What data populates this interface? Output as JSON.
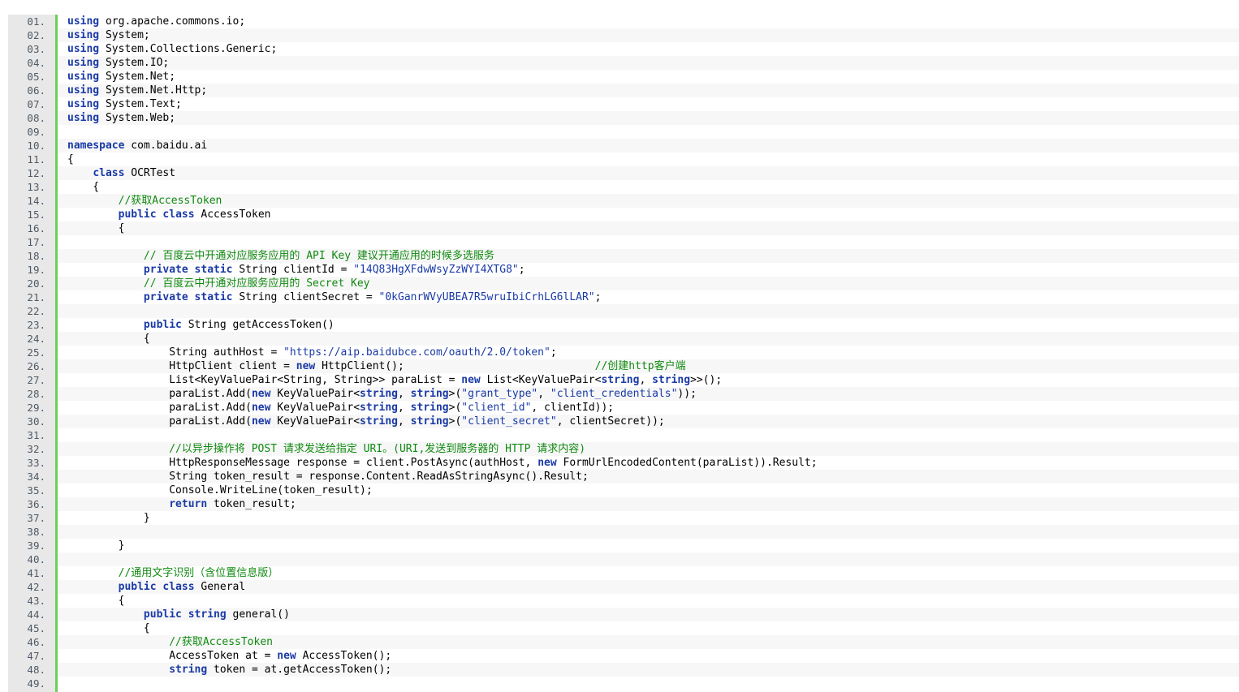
{
  "viewer": {
    "accent_gutter": "#6ccf5a",
    "colors": {
      "keyword": "#1a3aa6",
      "string": "#1a3aa6",
      "comment": "#108a10",
      "text": "#000000"
    },
    "lines": [
      {
        "n": "01.",
        "t": [
          [
            "kw",
            "using"
          ],
          [
            "tx",
            " org.apache.commons.io;"
          ]
        ]
      },
      {
        "n": "02.",
        "t": [
          [
            "kw",
            "using"
          ],
          [
            "tx",
            " System;"
          ]
        ]
      },
      {
        "n": "03.",
        "t": [
          [
            "kw",
            "using"
          ],
          [
            "tx",
            " System.Collections.Generic;"
          ]
        ]
      },
      {
        "n": "04.",
        "t": [
          [
            "kw",
            "using"
          ],
          [
            "tx",
            " System.IO;"
          ]
        ]
      },
      {
        "n": "05.",
        "t": [
          [
            "kw",
            "using"
          ],
          [
            "tx",
            " System.Net;"
          ]
        ]
      },
      {
        "n": "06.",
        "t": [
          [
            "kw",
            "using"
          ],
          [
            "tx",
            " System.Net.Http;"
          ]
        ]
      },
      {
        "n": "07.",
        "t": [
          [
            "kw",
            "using"
          ],
          [
            "tx",
            " System.Text;"
          ]
        ]
      },
      {
        "n": "08.",
        "t": [
          [
            "kw",
            "using"
          ],
          [
            "tx",
            " System.Web;"
          ]
        ]
      },
      {
        "n": "09.",
        "t": []
      },
      {
        "n": "10.",
        "t": [
          [
            "kw",
            "namespace"
          ],
          [
            "tx",
            " com.baidu.ai"
          ]
        ]
      },
      {
        "n": "11.",
        "t": [
          [
            "tx",
            "{"
          ]
        ]
      },
      {
        "n": "12.",
        "t": [
          [
            "tx",
            "    "
          ],
          [
            "kw",
            "class"
          ],
          [
            "tx",
            " OCRTest"
          ]
        ]
      },
      {
        "n": "13.",
        "t": [
          [
            "tx",
            "    {"
          ]
        ]
      },
      {
        "n": "14.",
        "t": [
          [
            "tx",
            "        "
          ],
          [
            "cmt",
            "//获取AccessToken"
          ]
        ]
      },
      {
        "n": "15.",
        "t": [
          [
            "tx",
            "        "
          ],
          [
            "kw",
            "public"
          ],
          [
            "tx",
            " "
          ],
          [
            "kw",
            "class"
          ],
          [
            "tx",
            " AccessToken"
          ]
        ]
      },
      {
        "n": "16.",
        "t": [
          [
            "tx",
            "        {"
          ]
        ]
      },
      {
        "n": "17.",
        "t": []
      },
      {
        "n": "18.",
        "t": [
          [
            "tx",
            "            "
          ],
          [
            "cmt",
            "// 百度云中开通对应服务应用的 API Key 建议开通应用的时候多选服务"
          ]
        ]
      },
      {
        "n": "19.",
        "t": [
          [
            "tx",
            "            "
          ],
          [
            "kw",
            "private"
          ],
          [
            "tx",
            " "
          ],
          [
            "kw",
            "static"
          ],
          [
            "tx",
            " String clientId = "
          ],
          [
            "str",
            "\"14Q83HgXFdwWsyZzWYI4XTG8\""
          ],
          [
            "tx",
            ";"
          ]
        ]
      },
      {
        "n": "20.",
        "t": [
          [
            "tx",
            "            "
          ],
          [
            "cmt",
            "// 百度云中开通对应服务应用的 Secret Key"
          ]
        ]
      },
      {
        "n": "21.",
        "t": [
          [
            "tx",
            "            "
          ],
          [
            "kw",
            "private"
          ],
          [
            "tx",
            " "
          ],
          [
            "kw",
            "static"
          ],
          [
            "tx",
            " String clientSecret = "
          ],
          [
            "str",
            "\"0kGanrWVyUBEA7R5wruIbiCrhLG6lLAR\""
          ],
          [
            "tx",
            ";"
          ]
        ]
      },
      {
        "n": "22.",
        "t": []
      },
      {
        "n": "23.",
        "t": [
          [
            "tx",
            "            "
          ],
          [
            "kw",
            "public"
          ],
          [
            "tx",
            " String getAccessToken()"
          ]
        ]
      },
      {
        "n": "24.",
        "t": [
          [
            "tx",
            "            {"
          ]
        ]
      },
      {
        "n": "25.",
        "t": [
          [
            "tx",
            "                String authHost = "
          ],
          [
            "str",
            "\"https://aip.baidubce.com/oauth/2.0/token\""
          ],
          [
            "tx",
            ";"
          ]
        ]
      },
      {
        "n": "26.",
        "t": [
          [
            "tx",
            "                HttpClient client = "
          ],
          [
            "kw",
            "new"
          ],
          [
            "tx",
            " HttpClient();                              "
          ],
          [
            "cmt",
            "//创建http客户端"
          ]
        ]
      },
      {
        "n": "27.",
        "t": [
          [
            "tx",
            "                List<KeyValuePair<String, String>> paraList = "
          ],
          [
            "kw",
            "new"
          ],
          [
            "tx",
            " List<KeyValuePair<"
          ],
          [
            "kw",
            "string"
          ],
          [
            "tx",
            ", "
          ],
          [
            "kw",
            "string"
          ],
          [
            "tx",
            ">>();"
          ]
        ]
      },
      {
        "n": "28.",
        "t": [
          [
            "tx",
            "                paraList.Add("
          ],
          [
            "kw",
            "new"
          ],
          [
            "tx",
            " KeyValuePair<"
          ],
          [
            "kw",
            "string"
          ],
          [
            "tx",
            ", "
          ],
          [
            "kw",
            "string"
          ],
          [
            "tx",
            ">("
          ],
          [
            "str",
            "\"grant_type\""
          ],
          [
            "tx",
            ", "
          ],
          [
            "str",
            "\"client_credentials\""
          ],
          [
            "tx",
            "));"
          ]
        ]
      },
      {
        "n": "29.",
        "t": [
          [
            "tx",
            "                paraList.Add("
          ],
          [
            "kw",
            "new"
          ],
          [
            "tx",
            " KeyValuePair<"
          ],
          [
            "kw",
            "string"
          ],
          [
            "tx",
            ", "
          ],
          [
            "kw",
            "string"
          ],
          [
            "tx",
            ">("
          ],
          [
            "str",
            "\"client_id\""
          ],
          [
            "tx",
            ", clientId));"
          ]
        ]
      },
      {
        "n": "30.",
        "t": [
          [
            "tx",
            "                paraList.Add("
          ],
          [
            "kw",
            "new"
          ],
          [
            "tx",
            " KeyValuePair<"
          ],
          [
            "kw",
            "string"
          ],
          [
            "tx",
            ", "
          ],
          [
            "kw",
            "string"
          ],
          [
            "tx",
            ">("
          ],
          [
            "str",
            "\"client_secret\""
          ],
          [
            "tx",
            ", clientSecret));"
          ]
        ]
      },
      {
        "n": "31.",
        "t": []
      },
      {
        "n": "32.",
        "t": [
          [
            "tx",
            "                "
          ],
          [
            "cmt",
            "//以异步操作将 POST 请求发送给指定 URI。(URI,发送到服务器的 HTTP 请求内容)"
          ]
        ]
      },
      {
        "n": "33.",
        "t": [
          [
            "tx",
            "                HttpResponseMessage response = client.PostAsync(authHost, "
          ],
          [
            "kw",
            "new"
          ],
          [
            "tx",
            " FormUrlEncodedContent(paraList)).Result;"
          ]
        ]
      },
      {
        "n": "34.",
        "t": [
          [
            "tx",
            "                String token_result = response.Content.ReadAsStringAsync().Result;"
          ]
        ]
      },
      {
        "n": "35.",
        "t": [
          [
            "tx",
            "                Console.WriteLine(token_result);"
          ]
        ]
      },
      {
        "n": "36.",
        "t": [
          [
            "tx",
            "                "
          ],
          [
            "kw",
            "return"
          ],
          [
            "tx",
            " token_result;"
          ]
        ]
      },
      {
        "n": "37.",
        "t": [
          [
            "tx",
            "            }"
          ]
        ]
      },
      {
        "n": "38.",
        "t": []
      },
      {
        "n": "39.",
        "t": [
          [
            "tx",
            "        }"
          ]
        ]
      },
      {
        "n": "40.",
        "t": []
      },
      {
        "n": "41.",
        "t": [
          [
            "tx",
            "        "
          ],
          [
            "cmt",
            "//通用文字识别（含位置信息版）"
          ]
        ]
      },
      {
        "n": "42.",
        "t": [
          [
            "tx",
            "        "
          ],
          [
            "kw",
            "public"
          ],
          [
            "tx",
            " "
          ],
          [
            "kw",
            "class"
          ],
          [
            "tx",
            " General"
          ]
        ]
      },
      {
        "n": "43.",
        "t": [
          [
            "tx",
            "        {"
          ]
        ]
      },
      {
        "n": "44.",
        "t": [
          [
            "tx",
            "            "
          ],
          [
            "kw",
            "public"
          ],
          [
            "tx",
            " "
          ],
          [
            "kw",
            "string"
          ],
          [
            "tx",
            " general()"
          ]
        ]
      },
      {
        "n": "45.",
        "t": [
          [
            "tx",
            "            {"
          ]
        ]
      },
      {
        "n": "46.",
        "t": [
          [
            "tx",
            "                "
          ],
          [
            "cmt",
            "//获取AccessToken"
          ]
        ]
      },
      {
        "n": "47.",
        "t": [
          [
            "tx",
            "                AccessToken at = "
          ],
          [
            "kw",
            "new"
          ],
          [
            "tx",
            " AccessToken();"
          ]
        ]
      },
      {
        "n": "48.",
        "t": [
          [
            "tx",
            "                "
          ],
          [
            "kw",
            "string"
          ],
          [
            "tx",
            " token = at.getAccessToken();"
          ]
        ]
      },
      {
        "n": "49.",
        "t": []
      }
    ]
  }
}
